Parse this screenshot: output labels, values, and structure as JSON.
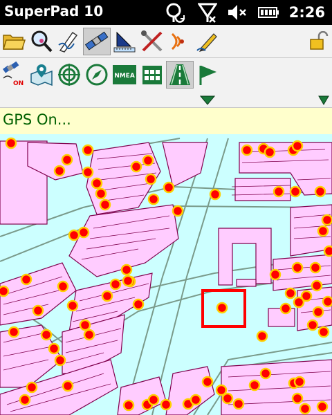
{
  "app": {
    "title": "SuperPad 10",
    "clock": "2:26"
  },
  "status_icons": [
    "gps-sync-icon",
    "signal-off-icon",
    "volume-mute-icon",
    "battery-icon"
  ],
  "toolbar_row1": {
    "icons": [
      "open-folder-icon",
      "search-zoom-icon",
      "pen-edit-icon",
      "satellite-icon",
      "measure-ruler-icon",
      "tools-icon",
      "wireless-icon",
      "pencil-note-icon",
      "unlock-icon"
    ],
    "active": "satellite-icon"
  },
  "toolbar_row2": {
    "icons": [
      "gps-on-icon",
      "map-location-icon",
      "target-crosshair-icon",
      "compass-icon",
      "nmea-icon",
      "calendar-icon",
      "road-icon",
      "flag-icon"
    ],
    "active": "road-icon",
    "nmea_label": "NMEA",
    "gps_on_label": "ON"
  },
  "status": {
    "message": "GPS On..."
  },
  "colors": {
    "map_background": "#ccffff",
    "building_fill": "#ffccff",
    "building_stroke": "#80004d",
    "road_line": "#7a9a8a",
    "point_fill": "#ff0000",
    "point_stroke": "#ffd000",
    "selection_box": "#ff0000",
    "status_text": "#006000",
    "status_bg": "#ffffcc"
  }
}
